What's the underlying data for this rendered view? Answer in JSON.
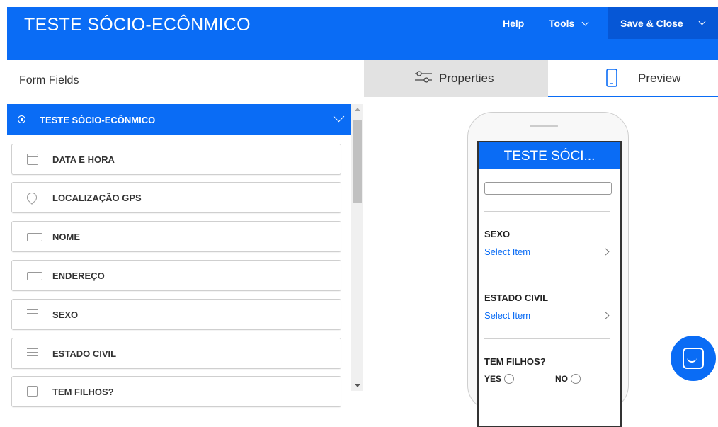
{
  "header": {
    "title": "TESTE SÓCIO-ECÔNMICO",
    "help_label": "Help",
    "tools_label": "Tools",
    "save_close_label": "Save & Close"
  },
  "left_panel": {
    "title": "Form Fields",
    "section_title": "TESTE SÓCIO-ECÔNMICO",
    "items": [
      {
        "label": "DATA E HORA",
        "icon": "calendar-icon"
      },
      {
        "label": "LOCALIZAÇÃO GPS",
        "icon": "location-pin-icon"
      },
      {
        "label": "NOME",
        "icon": "text-field-icon"
      },
      {
        "label": "ENDEREÇO",
        "icon": "text-field-icon"
      },
      {
        "label": "SEXO",
        "icon": "list-icon"
      },
      {
        "label": "ESTADO CIVIL",
        "icon": "list-icon"
      },
      {
        "label": "TEM FILHOS?",
        "icon": "checkbox-icon"
      }
    ]
  },
  "right_panel": {
    "tabs": [
      {
        "label": "Properties",
        "icon": "sliders-icon"
      },
      {
        "label": "Preview",
        "icon": "phone-icon"
      }
    ],
    "preview": {
      "title": "TESTE SÓCI...",
      "fields": [
        {
          "label": "SEXO",
          "value": "Select Item"
        },
        {
          "label": "ESTADO CIVIL",
          "value": "Select Item"
        },
        {
          "label": "TEM FILHOS?",
          "options": [
            "YES",
            "NO"
          ]
        }
      ]
    }
  },
  "colors": {
    "accent": "#0a6cf5",
    "accent_dark": "#0657d6",
    "tab_inactive": "#e2e2e2"
  }
}
